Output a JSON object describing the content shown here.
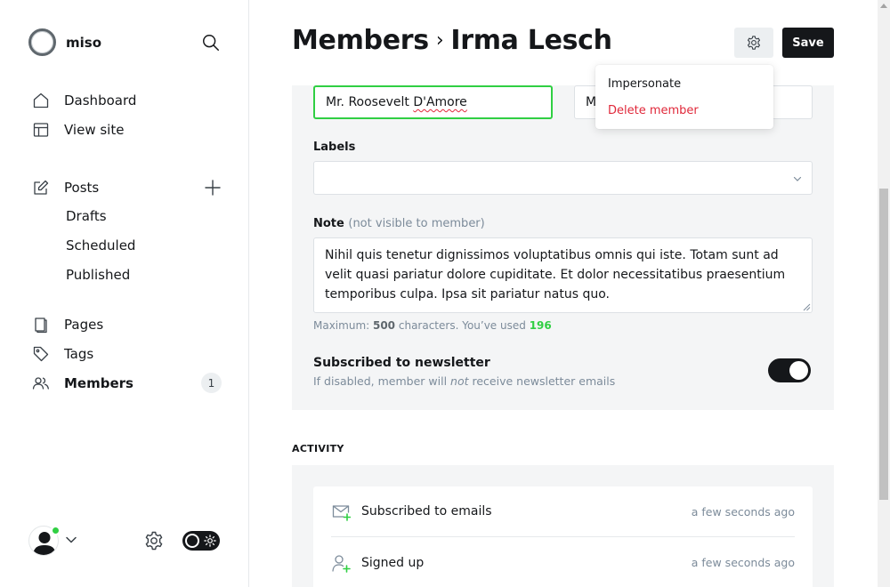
{
  "app": {
    "name": "miso"
  },
  "sidebar": {
    "nav": [
      {
        "label": "Dashboard",
        "icon": "home-icon"
      },
      {
        "label": "View site",
        "icon": "layout-icon"
      }
    ],
    "posts": {
      "label": "Posts",
      "icon": "pencil-square-icon",
      "subitems": [
        "Drafts",
        "Scheduled",
        "Published"
      ]
    },
    "more": [
      {
        "label": "Pages",
        "icon": "page-icon"
      },
      {
        "label": "Tags",
        "icon": "tag-icon"
      },
      {
        "label": "Members",
        "icon": "members-icon",
        "badge": "1",
        "active": true
      }
    ]
  },
  "header": {
    "section": "Members",
    "member_name": "Irma Lesch",
    "save_label": "Save"
  },
  "form": {
    "name_value": "Mr. Roosevelt D'Amore",
    "name_plain": "Mr. Roosevelt ",
    "name_flagged": "D'Amore",
    "email_value": "M",
    "labels_label": "Labels",
    "note_label": "Note",
    "note_hint": "(not visible to member)",
    "note_value": "Nihil quis tenetur dignissimos voluptatibus omnis qui iste. Totam sunt ad velit quasi pariatur dolore cupiditate. Et dolor necessitatibus praesentium temporibus culpa. Ipsa sit pariatur natus quo.",
    "char_prefix": "Maximum: ",
    "char_max": "500",
    "char_middle": " characters. You’ve used ",
    "char_used": "196",
    "newsletter_title": "Subscribed to newsletter",
    "newsletter_desc_1": "If disabled, member will ",
    "newsletter_desc_em": "not",
    "newsletter_desc_2": " receive newsletter emails",
    "newsletter_enabled": true
  },
  "dropdown": {
    "impersonate": "Impersonate",
    "delete": "Delete member"
  },
  "activity": {
    "heading": "ACTIVITY",
    "items": [
      {
        "text": "Subscribed to emails",
        "time": "a few seconds ago",
        "icon": "mail-plus-icon"
      },
      {
        "text": "Signed up",
        "time": "a few seconds ago",
        "icon": "user-plus-icon"
      }
    ]
  },
  "colors": {
    "accent_green": "#30cf43",
    "danger_red": "#e0283a",
    "dark": "#15171a"
  }
}
